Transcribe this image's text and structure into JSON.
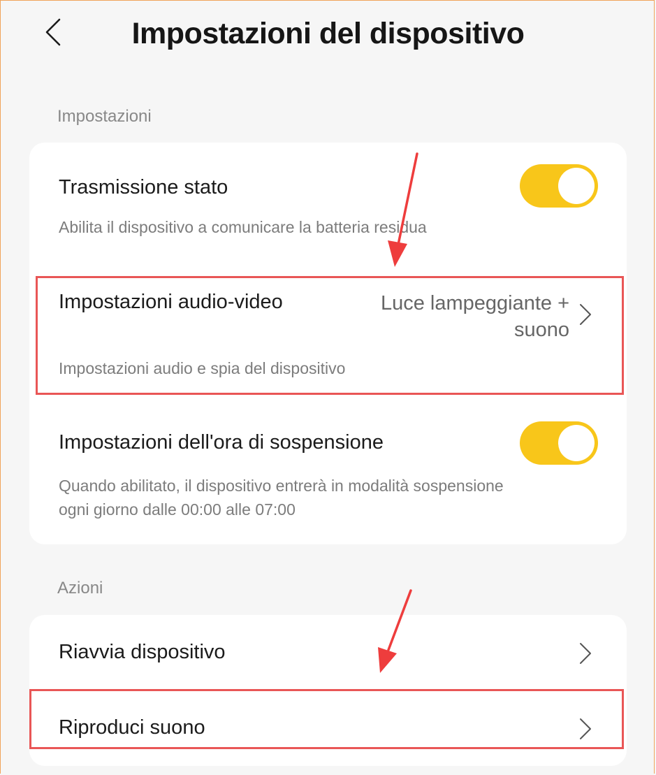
{
  "header": {
    "title": "Impostazioni del dispositivo"
  },
  "sections": {
    "settings_label": "Impostazioni",
    "actions_label": "Azioni"
  },
  "settings": {
    "status": {
      "title": "Trasmissione stato",
      "desc": "Abilita il dispositivo a comunicare la batteria residua",
      "enabled": true
    },
    "audio_video": {
      "title": "Impostazioni audio-video",
      "value_line1": "Luce lampeggiante +",
      "value_line2": "suono",
      "desc": "Impostazioni audio e spia del dispositivo"
    },
    "sleep": {
      "title": "Impostazioni dell'ora di sospensione",
      "desc_line1": "Quando abilitato, il dispositivo entrerà in modalità sospensione",
      "desc_line2": "ogni giorno dalle 00:00 alle 07:00",
      "enabled": true
    }
  },
  "actions": {
    "restart": "Riavvia dispositivo",
    "play_sound": "Riproduci suono"
  },
  "colors": {
    "toggle_on": "#f8c61a",
    "highlight": "#e95656",
    "background": "#f6f6f6"
  },
  "icons": [
    "back-chevron-icon",
    "chevron-right-icon"
  ]
}
